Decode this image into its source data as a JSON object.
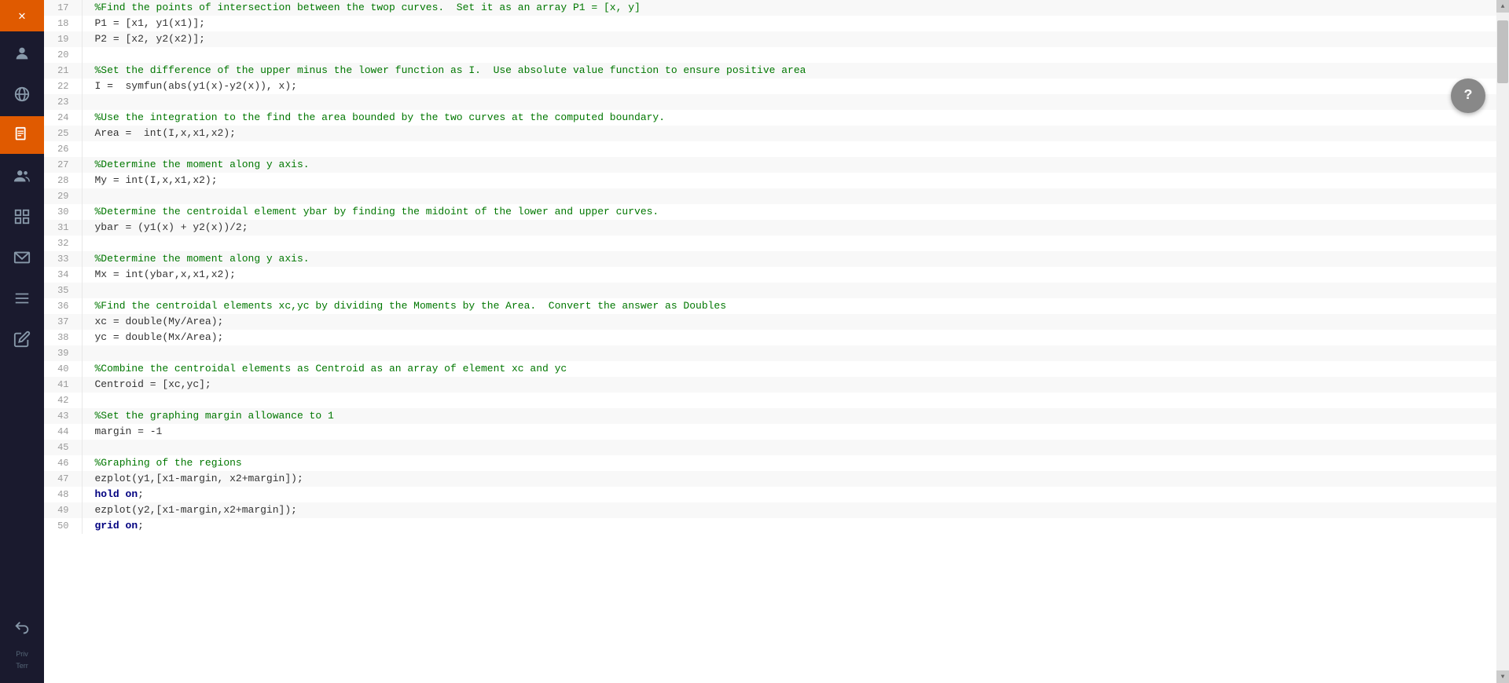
{
  "sidebar": {
    "close_label": "✕",
    "icons": [
      {
        "name": "user-icon",
        "symbol": "👤",
        "active": false
      },
      {
        "name": "globe-icon",
        "symbol": "🌐",
        "active": false
      },
      {
        "name": "document-icon",
        "symbol": "📋",
        "active": true
      },
      {
        "name": "group-icon",
        "symbol": "👥",
        "active": false
      },
      {
        "name": "grid-icon",
        "symbol": "⊞",
        "active": false
      },
      {
        "name": "mail-icon",
        "symbol": "✉",
        "active": false
      },
      {
        "name": "list-icon",
        "symbol": "≡",
        "active": false
      },
      {
        "name": "edit-icon",
        "symbol": "✏",
        "active": false
      },
      {
        "name": "back-icon",
        "symbol": "↩",
        "active": false
      }
    ],
    "bottom_text1": "Priv",
    "bottom_text2": "Terr"
  },
  "help_button": {
    "label": "?"
  },
  "code_lines": [
    {
      "num": 17,
      "type": "comment",
      "text": "%Find the points of intersection between the twop curves.  Set it as an array P1 = [x, y]"
    },
    {
      "num": 18,
      "type": "code",
      "text": "P1 = [x1, y1(x1)];"
    },
    {
      "num": 19,
      "type": "code",
      "text": "P2 = [x2, y2(x2)];"
    },
    {
      "num": 20,
      "type": "empty",
      "text": ""
    },
    {
      "num": 21,
      "type": "comment",
      "text": "%Set the difference of the upper minus the lower function as I.  Use absolute value function to ensure positive area"
    },
    {
      "num": 22,
      "type": "code",
      "text": "I =  symfun(abs(y1(x)-y2(x)), x);"
    },
    {
      "num": 23,
      "type": "empty",
      "text": ""
    },
    {
      "num": 24,
      "type": "comment",
      "text": "%Use the integration to the find the area bounded by the two curves at the computed boundary."
    },
    {
      "num": 25,
      "type": "code",
      "text": "Area =  int(I,x,x1,x2);"
    },
    {
      "num": 26,
      "type": "empty",
      "text": ""
    },
    {
      "num": 27,
      "type": "comment",
      "text": "%Determine the moment along y axis."
    },
    {
      "num": 28,
      "type": "code",
      "text": "My = int(I,x,x1,x2);"
    },
    {
      "num": 29,
      "type": "empty",
      "text": ""
    },
    {
      "num": 30,
      "type": "comment",
      "text": "%Determine the centroidal element ybar by finding the midoint of the lower and upper curves."
    },
    {
      "num": 31,
      "type": "code",
      "text": "ybar = (y1(x) + y2(x))/2;"
    },
    {
      "num": 32,
      "type": "empty",
      "text": ""
    },
    {
      "num": 33,
      "type": "comment",
      "text": "%Determine the moment along y axis."
    },
    {
      "num": 34,
      "type": "code",
      "text": "Mx = int(ybar,x,x1,x2);"
    },
    {
      "num": 35,
      "type": "empty",
      "text": ""
    },
    {
      "num": 36,
      "type": "comment",
      "text": "%Find the centroidal elements xc,yc by dividing the Moments by the Area.  Convert the answer as Doubles"
    },
    {
      "num": 37,
      "type": "code",
      "text": "xc = double(My/Area);"
    },
    {
      "num": 38,
      "type": "code",
      "text": "yc = double(Mx/Area);"
    },
    {
      "num": 39,
      "type": "empty",
      "text": ""
    },
    {
      "num": 40,
      "type": "comment",
      "text": "%Combine the centroidal elements as Centroid as an array of element xc and yc"
    },
    {
      "num": 41,
      "type": "code",
      "text": "Centroid = [xc,yc];"
    },
    {
      "num": 42,
      "type": "empty",
      "text": ""
    },
    {
      "num": 43,
      "type": "comment",
      "text": "%Set the graphing margin allowance to 1"
    },
    {
      "num": 44,
      "type": "code",
      "text": "margin = -1"
    },
    {
      "num": 45,
      "type": "empty",
      "text": ""
    },
    {
      "num": 46,
      "type": "comment",
      "text": "%Graphing of the regions"
    },
    {
      "num": 47,
      "type": "code",
      "text": "ezplot(y1,[x1-margin, x2+margin]);"
    },
    {
      "num": 48,
      "type": "code_kw",
      "text": "hold on;"
    },
    {
      "num": 49,
      "type": "code",
      "text": "ezplot(y2,[x1-margin,x2+margin]);"
    },
    {
      "num": 50,
      "type": "code_kw",
      "text": "grid on;"
    }
  ]
}
